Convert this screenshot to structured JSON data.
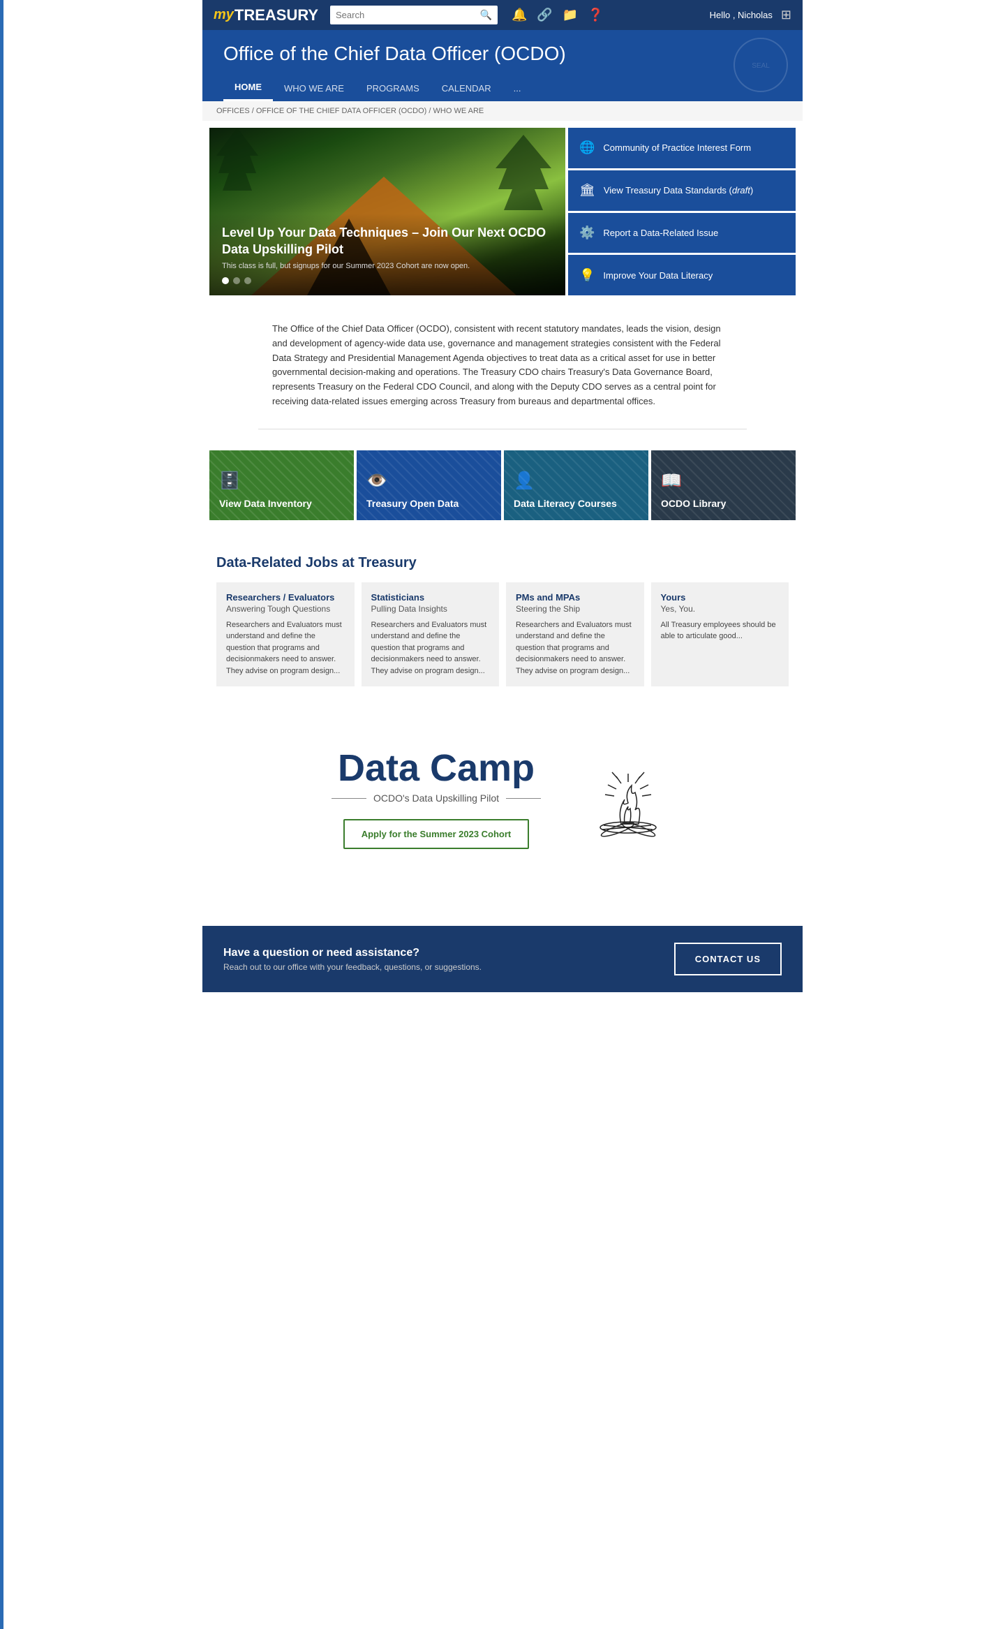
{
  "topnav": {
    "logo_my": "my",
    "logo_treasury": "TREASURY",
    "search_placeholder": "Search",
    "greeting": "Hello , Nicholas"
  },
  "header": {
    "title": "Office of the Chief Data Officer (OCDO)",
    "nav": [
      {
        "label": "HOME",
        "active": true
      },
      {
        "label": "WHO WE ARE",
        "active": false
      },
      {
        "label": "PROGRAMS",
        "active": false
      },
      {
        "label": "CALENDAR",
        "active": false
      },
      {
        "label": "...",
        "active": false
      }
    ]
  },
  "breadcrumb": {
    "items": [
      "OFFICES",
      "OFFICE OF THE CHIEF DATA OFFICER (OCDO)",
      "WHO WE ARE"
    ]
  },
  "hero": {
    "slide_title": "Level Up Your Data Techniques – Join Our Next OCDO Data Upskilling Pilot",
    "slide_subtitle": "This class is full, but signups for our Summer 2023 Cohort are now open.",
    "dots": 3,
    "links": [
      {
        "icon": "🌐",
        "label": "Community of Practice Interest Form"
      },
      {
        "icon": "🏛",
        "label": "View Treasury Data Standards (draft)"
      },
      {
        "icon": "⚙",
        "label": "Report a Data-Related Issue"
      },
      {
        "icon": "💡",
        "label": "Improve Your Data Literacy"
      }
    ]
  },
  "description": {
    "text": "The Office of the Chief Data Officer (OCDO), consistent with recent statutory mandates, leads the vision, design and development of agency-wide data use, governance and management strategies consistent with the Federal Data Strategy and Presidential Management Agenda objectives to treat data as a critical asset for use in better governmental decision-making and operations. The Treasury CDO chairs Treasury's Data Governance Board, represents Treasury on the Federal CDO Council, and along with the Deputy CDO serves as a central point for receiving data-related issues emerging across Treasury from bureaus and departmental offices."
  },
  "quicklinks": [
    {
      "icon": "🗄",
      "label": "View Data Inventory",
      "color": "green"
    },
    {
      "icon": "👁",
      "label": "Treasury Open Data",
      "color": "blue"
    },
    {
      "icon": "👤",
      "label": "Data Literacy Courses",
      "color": "teal"
    },
    {
      "icon": "📖",
      "label": "OCDO Library",
      "color": "dark"
    }
  ],
  "jobs": {
    "section_title": "Data-Related Jobs at Treasury",
    "cards": [
      {
        "title": "Researchers / Evaluators",
        "subtitle": "Answering Tough Questions",
        "body": "Researchers and Evaluators must understand and define the question that programs and decisionmakers need to answer. They advise on program design..."
      },
      {
        "title": "Statisticians",
        "subtitle": "Pulling Data Insights",
        "body": "Researchers and Evaluators must understand and define the question that programs and decisionmakers need to answer. They advise on program design..."
      },
      {
        "title": "PMs and MPAs",
        "subtitle": "Steering the Ship",
        "body": "Researchers and Evaluators must understand and define the question that programs and decisionmakers need to answer. They advise on program design..."
      },
      {
        "title": "Yours",
        "subtitle": "Yes, You.",
        "body": "All Treasury employees should be able to articulate good..."
      }
    ]
  },
  "datacamp": {
    "title": "Data Camp",
    "subtitle": "OCDO's Data Upskilling Pilot",
    "apply_label": "Apply for the Summer 2023 Cohort"
  },
  "footer": {
    "question": "Have a question or need assistance?",
    "subtext": "Reach out to our office with your feedback, questions, or suggestions.",
    "contact_label": "CONTACT US"
  }
}
